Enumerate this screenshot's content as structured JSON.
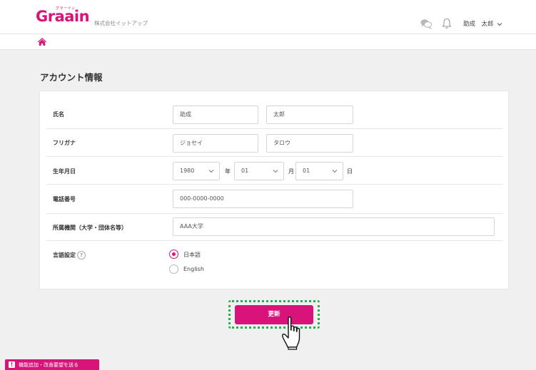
{
  "header": {
    "logo_text": "Graain",
    "logo_ruby": "グラーイン",
    "company": "株式会社イットアップ",
    "username": "助成　太郎"
  },
  "page": {
    "title": "アカウント情報"
  },
  "form": {
    "name": {
      "label": "氏名",
      "last": "助成",
      "first": "太郎"
    },
    "kana": {
      "label": "フリガナ",
      "last": "ジョセイ",
      "first": "タロウ"
    },
    "birthday": {
      "label": "生年月日",
      "year": "1980",
      "year_unit": "年",
      "month": "01",
      "month_unit": "月",
      "day": "01",
      "day_unit": "日"
    },
    "phone": {
      "label": "電話番号",
      "value": "000-0000-0000"
    },
    "affiliation": {
      "label": "所属機関（大学・団体名等）",
      "value": "AAA大学"
    },
    "language": {
      "label": "言語設定",
      "help": "?",
      "options": [
        {
          "label": "日本語",
          "selected": true
        },
        {
          "label": "English",
          "selected": false
        }
      ]
    }
  },
  "actions": {
    "update_label": "更新"
  },
  "feedback": {
    "icon": "!",
    "label": "機能追加・改善要望を送る"
  },
  "colors": {
    "brand": "#d8137a",
    "highlight": "#23b14d"
  }
}
